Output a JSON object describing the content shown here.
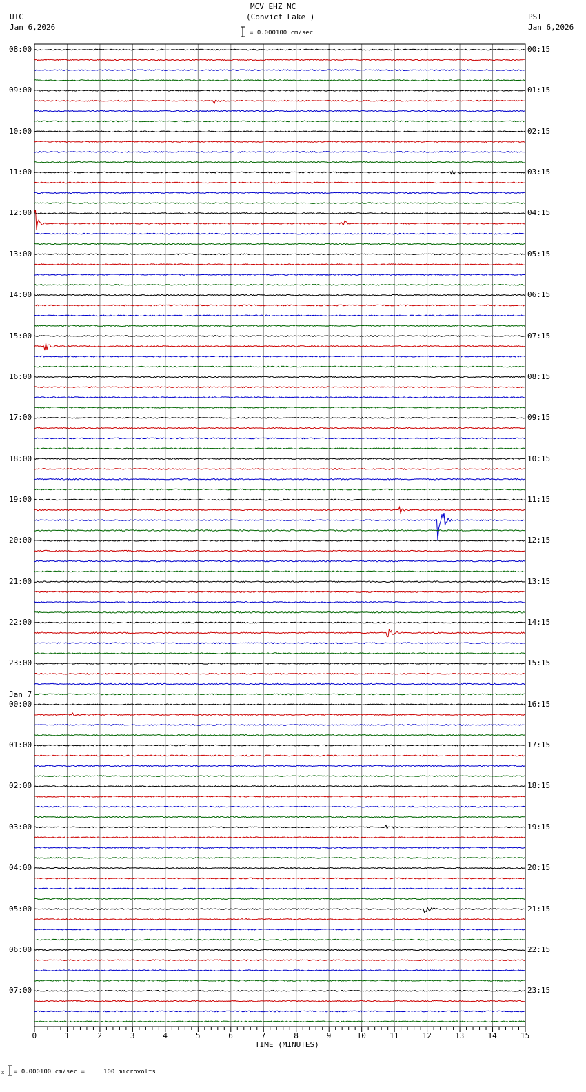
{
  "header": {
    "station": "MCV EHZ NC",
    "location": "(Convict Lake )",
    "left_tz": "UTC",
    "left_date": "Jan 6,2026",
    "right_tz": "PST",
    "right_date": "Jan 6,2026",
    "scale_text": "= 0.000100 cm/sec"
  },
  "footer": {
    "scale_text": "= 0.000100 cm/sec =     100 microvolts",
    "mark": "x"
  },
  "chart_data": {
    "type": "line",
    "title": "MCV EHZ NC (Convict Lake )",
    "xlabel": "TIME (MINUTES)",
    "xlim": [
      0,
      15
    ],
    "x_ticks": [
      "0",
      "1",
      "2",
      "3",
      "4",
      "5",
      "6",
      "7",
      "8",
      "9",
      "10",
      "11",
      "12",
      "13",
      "14",
      "15"
    ],
    "trace_colors": [
      "#000000",
      "#cc0000",
      "#0000cc",
      "#006600"
    ],
    "traces_per_hour": 4,
    "trace_count": 96,
    "left_labels": [
      "08:00",
      "09:00",
      "10:00",
      "11:00",
      "12:00",
      "13:00",
      "14:00",
      "15:00",
      "16:00",
      "17:00",
      "18:00",
      "19:00",
      "20:00",
      "21:00",
      "22:00",
      "23:00",
      "00:00",
      "01:00",
      "02:00",
      "03:00",
      "04:00",
      "05:00",
      "06:00",
      "07:00"
    ],
    "date_change_label": "Jan 7",
    "date_change_hour_index": 16,
    "right_labels": [
      "00:15",
      "01:15",
      "02:15",
      "03:15",
      "04:15",
      "05:15",
      "06:15",
      "07:15",
      "08:15",
      "09:15",
      "10:15",
      "11:15",
      "12:15",
      "13:15",
      "14:15",
      "15:15",
      "16:15",
      "17:15",
      "18:15",
      "19:15",
      "20:15",
      "21:15",
      "22:15",
      "23:15"
    ],
    "events": [
      {
        "trace": 5,
        "minute": 5.5,
        "amplitude": 4
      },
      {
        "trace": 12,
        "minute": 12.75,
        "amplitude": 5
      },
      {
        "trace": 17,
        "minute": 9.4,
        "amplitude": 7
      },
      {
        "trace": 17,
        "minute": 0.02,
        "amplitude": 30
      },
      {
        "trace": 29,
        "minute": 0.35,
        "amplitude": 7
      },
      {
        "trace": 45,
        "minute": 11.2,
        "amplitude": 4
      },
      {
        "trace": 46,
        "minute": 12.35,
        "amplitude": 40
      },
      {
        "trace": 57,
        "minute": 10.8,
        "amplitude": 9
      },
      {
        "trace": 65,
        "minute": 1.2,
        "amplitude": 3
      },
      {
        "trace": 76,
        "minute": 10.7,
        "amplitude": 6
      },
      {
        "trace": 84,
        "minute": 11.95,
        "amplitude": 7
      }
    ]
  }
}
